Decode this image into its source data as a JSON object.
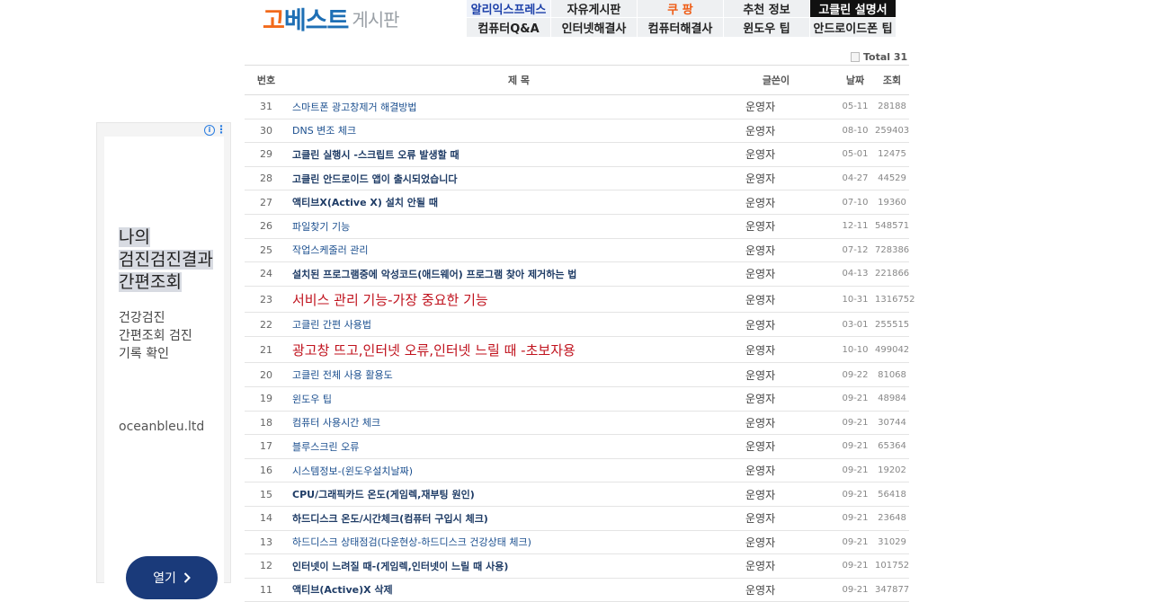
{
  "logo": {
    "main_a": "고",
    "main_b": "베스트",
    "sub": "게시판"
  },
  "nav": {
    "row1": [
      "알리익스프레스",
      "자유게시판",
      "쿠 팡",
      "추천 정보",
      "고클린 설명서"
    ],
    "row2": [
      "컴퓨터Q&A",
      "인터넷해결사",
      "컴퓨터해결사",
      "윈도우 팁",
      "안드로이드폰 팁"
    ]
  },
  "ad": {
    "info": "i",
    "menu": "⋮",
    "headline": [
      "나의",
      "검진검진결과",
      "간편조회"
    ],
    "desc": [
      "건강검진",
      "간편조회 검진",
      "기록 확인"
    ],
    "domain": "oceanbleu.ltd",
    "button": "열기",
    "button_icon": "chevron-right-icon"
  },
  "board": {
    "total": "Total 31",
    "headers": {
      "num": "번호",
      "title": "제 목",
      "writer": "글쓴이",
      "date": "날짜",
      "views": "조회"
    },
    "rows": [
      {
        "num": "31",
        "title": "스마트폰 광고창제거 해결방법",
        "writer": "운영자",
        "date": "05-11",
        "views": "28188",
        "style": "normal"
      },
      {
        "num": "30",
        "title": "DNS 변조 체크",
        "writer": "운영자",
        "date": "08-10",
        "views": "259403",
        "style": "normal"
      },
      {
        "num": "29",
        "title": "고클린 실행시 -스크립트 오류 발생할 때",
        "writer": "운영자",
        "date": "05-01",
        "views": "12475",
        "style": "bold"
      },
      {
        "num": "28",
        "title": "고클린 안드로이드 앱이 출시되었습니다",
        "writer": "운영자",
        "date": "04-27",
        "views": "44529",
        "style": "bold"
      },
      {
        "num": "27",
        "title": "액티브X(Active X) 설치 안될 때",
        "writer": "운영자",
        "date": "07-10",
        "views": "19360",
        "style": "bold"
      },
      {
        "num": "26",
        "title": "파일찾기 기능",
        "writer": "운영자",
        "date": "12-11",
        "views": "548571",
        "style": "normal"
      },
      {
        "num": "25",
        "title": "작업스케줄러 관리",
        "writer": "운영자",
        "date": "07-12",
        "views": "728386",
        "style": "normal"
      },
      {
        "num": "24",
        "title": "설치된 프로그램중에 악성코드(애드웨어) 프로그램 찾아 제거하는 법",
        "writer": "운영자",
        "date": "04-13",
        "views": "221866",
        "style": "bold"
      },
      {
        "num": "23",
        "title": "서비스 관리 기능-가장 중요한 기능",
        "writer": "운영자",
        "date": "10-31",
        "views": "1316752",
        "style": "red"
      },
      {
        "num": "22",
        "title": "고클린 간편 사용법",
        "writer": "운영자",
        "date": "03-01",
        "views": "255515",
        "style": "normal"
      },
      {
        "num": "21",
        "title": "광고창 뜨고,인터넷 오류,인터넷 느릴 때 -초보자용",
        "writer": "운영자",
        "date": "10-10",
        "views": "499042",
        "style": "red"
      },
      {
        "num": "20",
        "title": "고클린 전체 사용 활용도",
        "writer": "운영자",
        "date": "09-22",
        "views": "81068",
        "style": "normal"
      },
      {
        "num": "19",
        "title": "윈도우 팁",
        "writer": "운영자",
        "date": "09-21",
        "views": "48984",
        "style": "normal"
      },
      {
        "num": "18",
        "title": "컴퓨터 사용시간 체크",
        "writer": "운영자",
        "date": "09-21",
        "views": "30744",
        "style": "normal"
      },
      {
        "num": "17",
        "title": "블루스크린 오류",
        "writer": "운영자",
        "date": "09-21",
        "views": "65364",
        "style": "normal"
      },
      {
        "num": "16",
        "title": "시스템정보-(윈도우설치날짜)",
        "writer": "운영자",
        "date": "09-21",
        "views": "19202",
        "style": "normal"
      },
      {
        "num": "15",
        "title": "CPU/그래픽카드 온도(게임렉,재부팅 원인)",
        "writer": "운영자",
        "date": "09-21",
        "views": "56418",
        "style": "bold"
      },
      {
        "num": "14",
        "title": "하드디스크 온도/시간체크(컴퓨터 구입시 체크)",
        "writer": "운영자",
        "date": "09-21",
        "views": "23648",
        "style": "bold"
      },
      {
        "num": "13",
        "title": "하드디스크 상태점검(다운현상-하드디스크 건강상태 체크)",
        "writer": "운영자",
        "date": "09-21",
        "views": "31029",
        "style": "normal"
      },
      {
        "num": "12",
        "title": "인터넷이 느려질 때-(게임렉,인터넷이 느릴 때 사용)",
        "writer": "운영자",
        "date": "09-21",
        "views": "101752",
        "style": "bold"
      },
      {
        "num": "11",
        "title": "액티브(Active)X 삭제",
        "writer": "운영자",
        "date": "09-21",
        "views": "347877",
        "style": "bold"
      }
    ]
  }
}
